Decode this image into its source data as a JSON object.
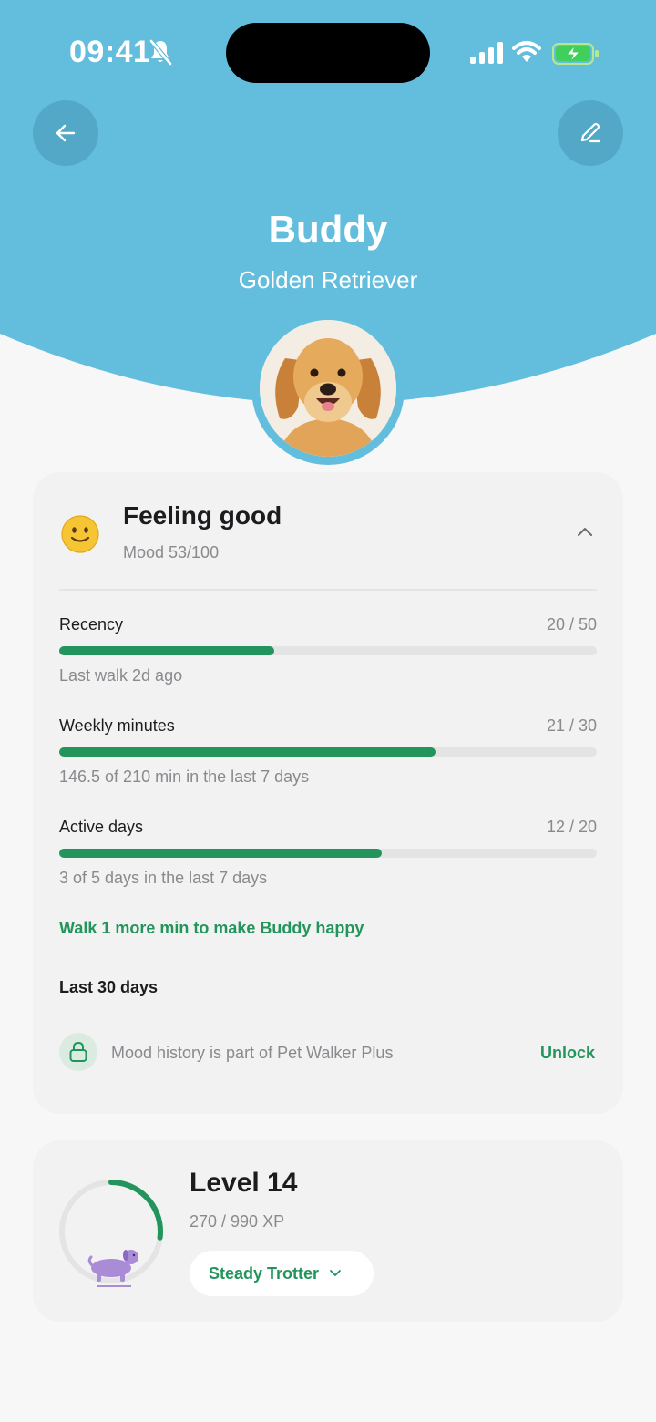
{
  "status_bar": {
    "time": "09:41"
  },
  "pet": {
    "name": "Buddy",
    "breed": "Golden Retriever"
  },
  "colors": {
    "header": "#63bedd",
    "accent": "#23955c",
    "background": "#f7f7f7",
    "card": "#f2f2f2"
  },
  "mood": {
    "title": "Feeling good",
    "subtitle": "Mood 53/100",
    "metrics": [
      {
        "label": "Recency",
        "score": "20 / 50",
        "fraction": 0.4,
        "note": "Last walk 2d ago"
      },
      {
        "label": "Weekly minutes",
        "score": "21 / 30",
        "fraction": 0.7,
        "note": "146.5 of 210 min in the last 7 days"
      },
      {
        "label": "Active days",
        "score": "12 / 20",
        "fraction": 0.6,
        "note": "3 of 5 days in the last 7 days"
      }
    ],
    "hint": "Walk 1 more min to make Buddy happy",
    "history_title": "Last 30 days",
    "locked_text": "Mood history is part of Pet Walker Plus",
    "unlock_label": "Unlock"
  },
  "level": {
    "title": "Level 14",
    "xp": "270 / 990 XP",
    "progress": 0.27,
    "badge": "Steady Trotter"
  },
  "icons": {
    "back": "arrow-left-icon",
    "edit": "pencil-icon",
    "collapse": "chevron-up-icon",
    "lock": "lock-icon",
    "badge_dropdown": "chevron-down-icon",
    "mascot": "dog-icon"
  }
}
